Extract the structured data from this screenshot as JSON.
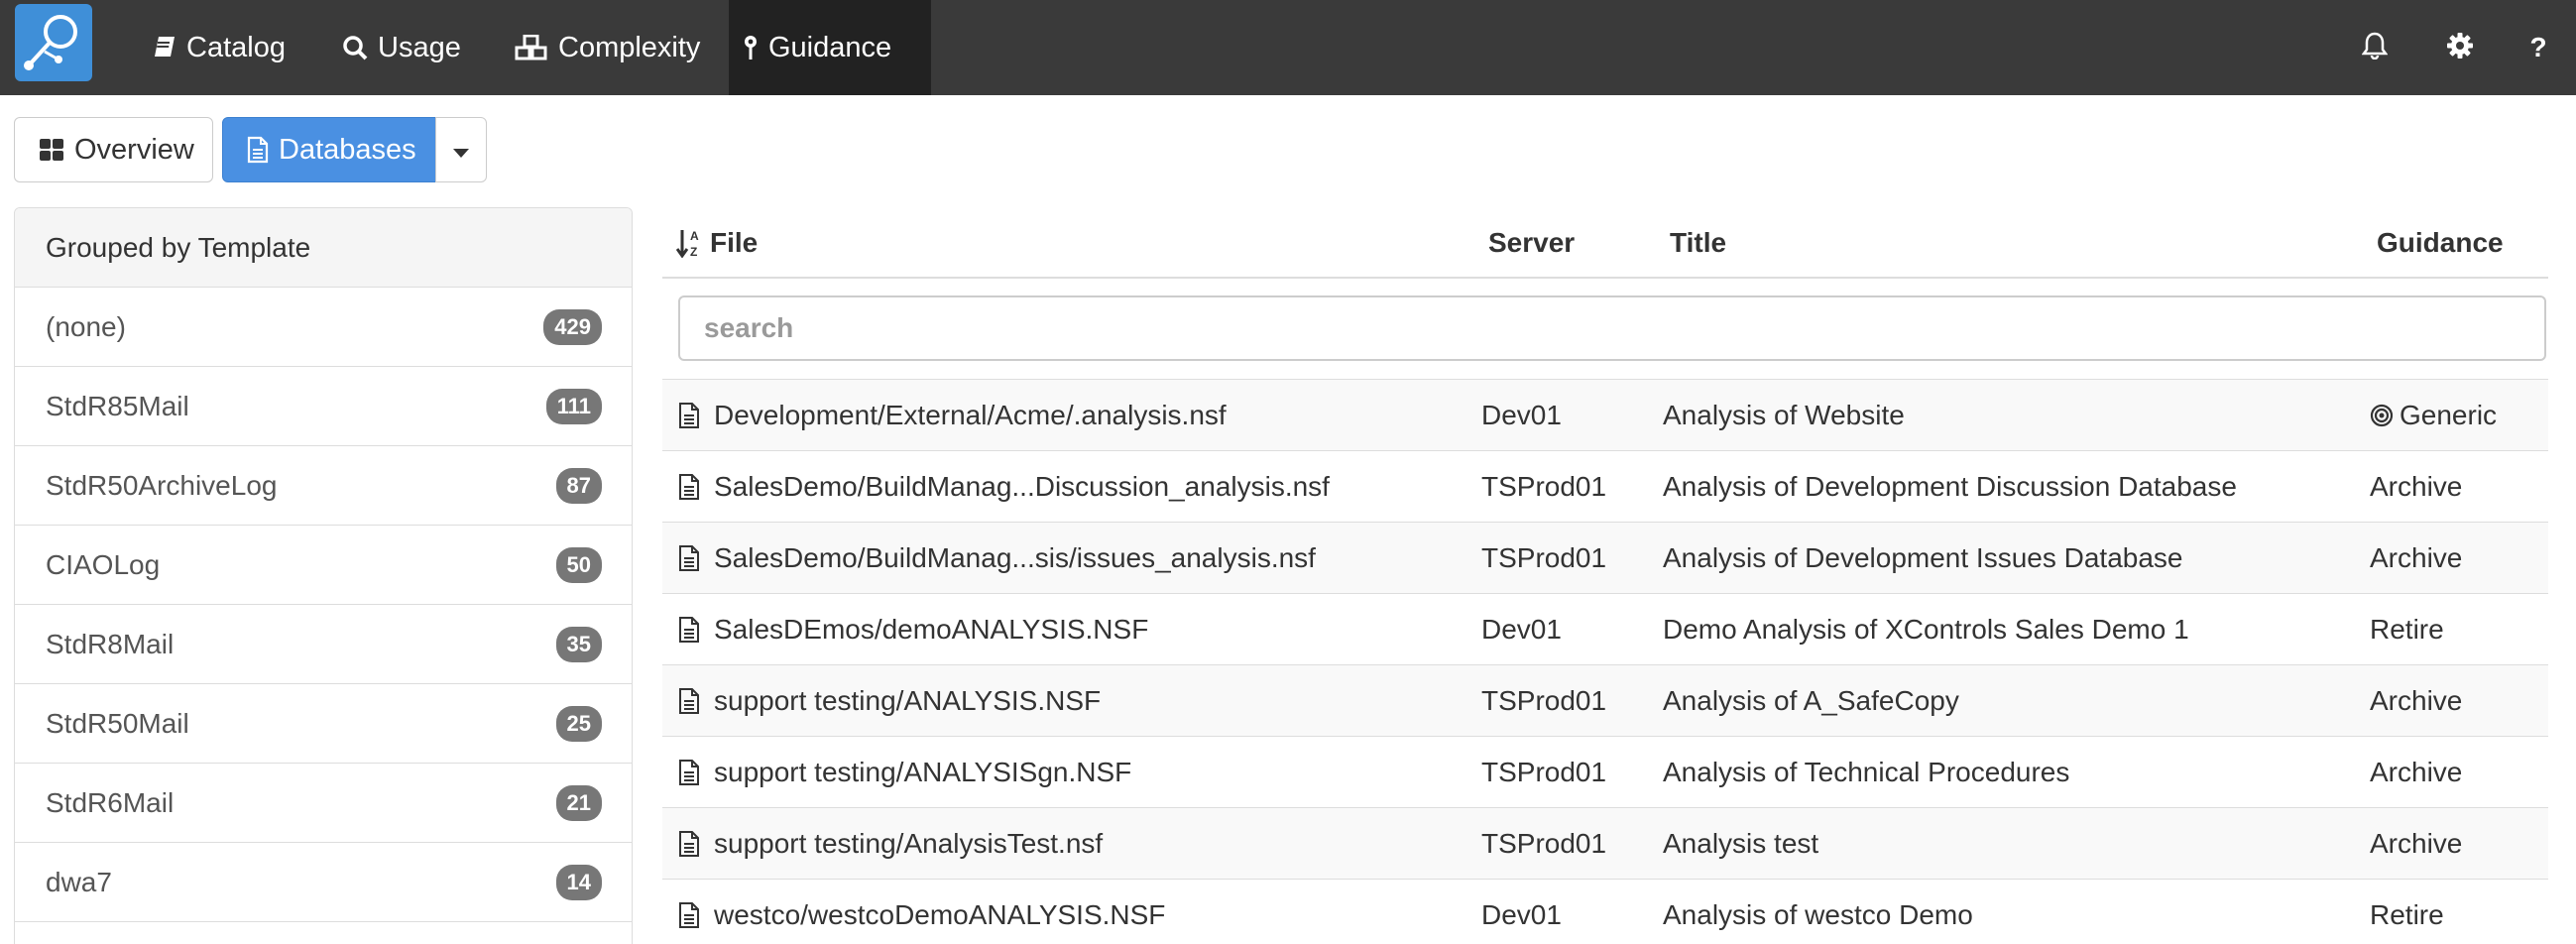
{
  "nav": {
    "items": [
      {
        "label": "Catalog",
        "icon": "book-icon"
      },
      {
        "label": "Usage",
        "icon": "search-icon"
      },
      {
        "label": "Complexity",
        "icon": "cubes-icon"
      },
      {
        "label": "Guidance",
        "icon": "map-marker-icon",
        "active": true
      }
    ],
    "right_icons": [
      "bell-icon",
      "gear-icon",
      "question-icon"
    ],
    "help_label": "?"
  },
  "toolbar": {
    "overview_label": "Overview",
    "databases_label": "Databases"
  },
  "groups": {
    "heading": "Grouped by Template",
    "items": [
      {
        "label": "(none)",
        "count": "429"
      },
      {
        "label": "StdR85Mail",
        "count": "111"
      },
      {
        "label": "StdR50ArchiveLog",
        "count": "87"
      },
      {
        "label": "CIAOLog",
        "count": "50"
      },
      {
        "label": "StdR8Mail",
        "count": "35"
      },
      {
        "label": "StdR50Mail",
        "count": "25"
      },
      {
        "label": "StdR6Mail",
        "count": "21"
      },
      {
        "label": "dwa7",
        "count": "14"
      }
    ]
  },
  "table": {
    "columns": {
      "file": "File",
      "server": "Server",
      "title": "Title",
      "guidance": "Guidance"
    },
    "search_placeholder": "search",
    "rows": [
      {
        "file": "Development/External/Acme/.analysis.nsf",
        "server": "Dev01",
        "title": "Analysis of Website",
        "guidance": "Generic",
        "guidance_icon": "bullseye-icon"
      },
      {
        "file": "SalesDemo/BuildManag...Discussion_analysis.nsf",
        "server": "TSProd01",
        "title": "Analysis of Development Discussion Database",
        "guidance": "Archive"
      },
      {
        "file": "SalesDemo/BuildManag...sis/issues_analysis.nsf",
        "server": "TSProd01",
        "title": "Analysis of Development Issues Database",
        "guidance": "Archive"
      },
      {
        "file": "SalesDEmos/demoANALYSIS.NSF",
        "server": "Dev01",
        "title": "Demo Analysis of XControls Sales Demo 1",
        "guidance": "Retire"
      },
      {
        "file": "support testing/ANALYSIS.NSF",
        "server": "TSProd01",
        "title": "Analysis of A_SafeCopy",
        "guidance": "Archive"
      },
      {
        "file": "support testing/ANALYSISgn.NSF",
        "server": "TSProd01",
        "title": "Analysis of Technical Procedures",
        "guidance": "Archive"
      },
      {
        "file": "support testing/AnalysisTest.nsf",
        "server": "TSProd01",
        "title": "Analysis test",
        "guidance": "Archive"
      },
      {
        "file": "westco/westcoDemoANALYSIS.NSF",
        "server": "Dev01",
        "title": "Analysis of westco Demo",
        "guidance": "Retire"
      }
    ]
  },
  "colors": {
    "navbar": "#3a3a3a",
    "nav_active": "#222222",
    "accent": "#4a90e2",
    "badge": "#777777"
  }
}
